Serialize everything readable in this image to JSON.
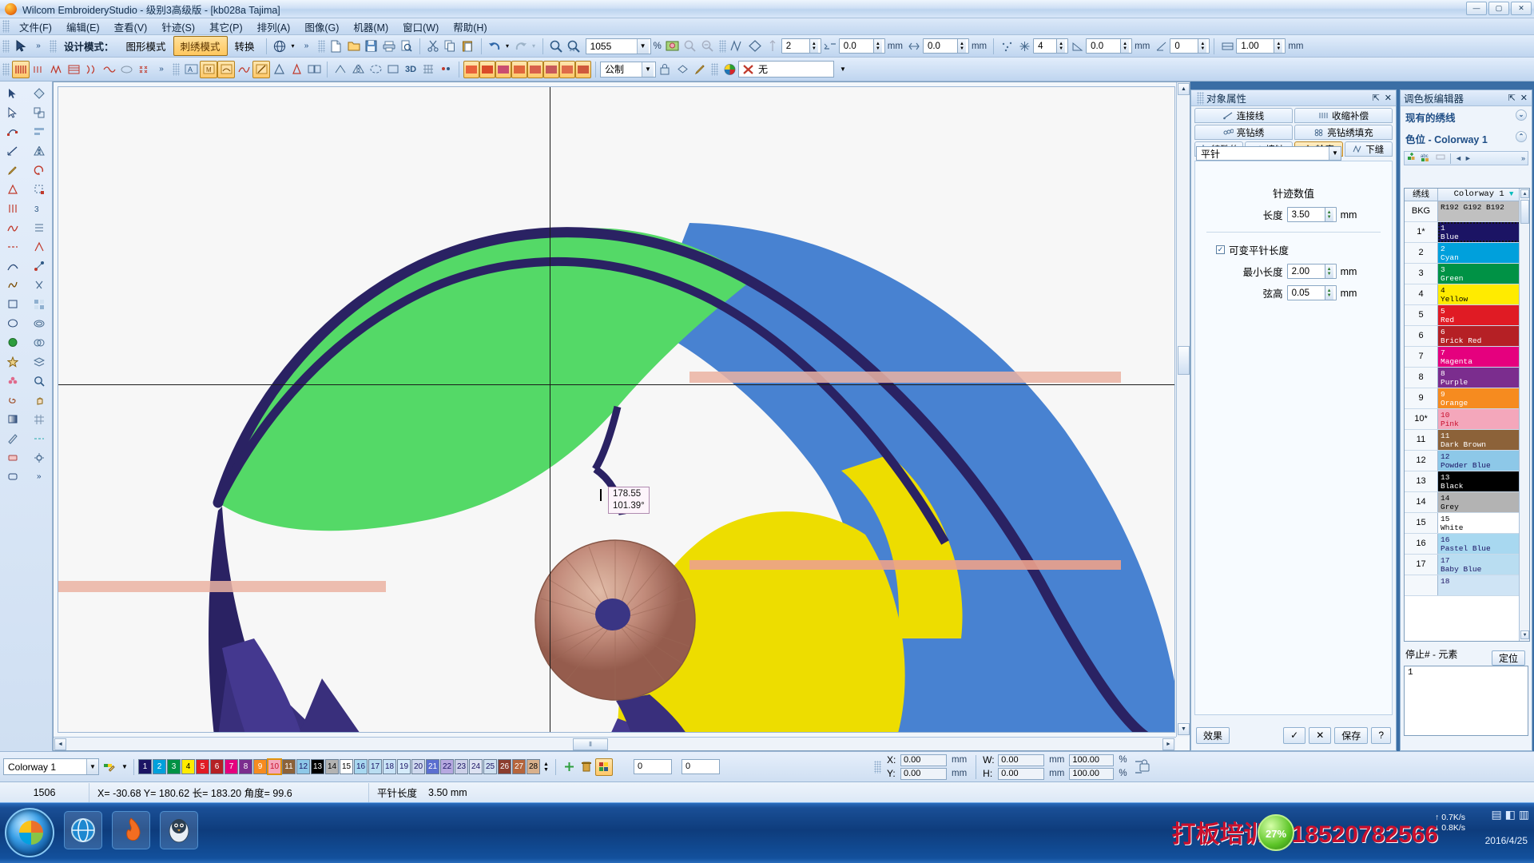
{
  "window": {
    "title": "Wilcom EmbroideryStudio - 级别3高级版 - [kb028a            Tajima]",
    "minimize": "—",
    "maximize": "▢",
    "close": "✕"
  },
  "menu": [
    "文件(F)",
    "编辑(E)",
    "查看(V)",
    "针迹(S)",
    "其它(P)",
    "排列(A)",
    "图像(G)",
    "机器(M)",
    "窗口(W)",
    "帮助(H)"
  ],
  "toolbar_mode": {
    "label": "设计模式：",
    "graphic": "图形模式",
    "embroidery": "刺绣模式",
    "convert": "转换"
  },
  "toolbar_values": {
    "zoom": "1055",
    "zoom_unit": "%",
    "f1": "0.0",
    "u1": "mm",
    "f2": "2",
    "f3": "0.0",
    "u3": "mm",
    "f4": "4",
    "f5": "0.0",
    "u5": "mm",
    "f6": "0",
    "f7": "1.00",
    "u7": "mm"
  },
  "toolbar_row2": {
    "layer_combo": "公制",
    "none_label": "无"
  },
  "canvas": {
    "tooltip_len": "178.55",
    "tooltip_angle": "101.39°"
  },
  "object_properties": {
    "title": "对象属性",
    "pin": "⇱",
    "close": "✕",
    "tabs_row1": [
      "连接线",
      "收缩补偿"
    ],
    "tabs_row2": [
      "亮钻绣",
      "亮钻绣填充"
    ],
    "tabs_row3": [
      "特殊的",
      "填针",
      "轮廓",
      "下缝"
    ],
    "active_tab": "轮廓",
    "stitch_type": "平针",
    "group_title": "针迹数值",
    "length_label": "长度",
    "length_value": "3.50",
    "length_unit": "mm",
    "variable_checkbox": "可变平针长度",
    "min_length_label": "最小长度",
    "min_length_value": "2.00",
    "min_length_unit": "mm",
    "chord_label": "弦高",
    "chord_value": "0.05",
    "chord_unit": "mm",
    "footer": {
      "effect": "效果",
      "apply": "✓",
      "cancel": "✕",
      "save": "保存",
      "help": "?"
    }
  },
  "palette": {
    "title": "调色板编辑器",
    "pin": "⇱",
    "close": "✕",
    "section_existing": "现有的绣线",
    "section_colorway": "色位 - Colorway 1",
    "header_thread": "绣线",
    "header_colorway": "Colorway 1",
    "rows": [
      {
        "n": "BKG",
        "num": "",
        "name": "R192 G192 B192",
        "color": "#c0c0c0",
        "text": "#000000",
        "selected": false
      },
      {
        "n": "1*",
        "num": "1",
        "name": "Blue",
        "color": "#1b1464",
        "text": "#ffffff",
        "selected": true
      },
      {
        "n": "2",
        "num": "2",
        "name": "Cyan",
        "color": "#00a0dc",
        "text": "#ffffff",
        "selected": false
      },
      {
        "n": "3",
        "num": "3",
        "name": "Green",
        "color": "#009245",
        "text": "#ffffff",
        "selected": false
      },
      {
        "n": "4",
        "num": "4",
        "name": "Yellow",
        "color": "#ffeb00",
        "text": "#000000",
        "selected": false
      },
      {
        "n": "5",
        "num": "5",
        "name": "Red",
        "color": "#e01b24",
        "text": "#ffffff",
        "selected": false
      },
      {
        "n": "6",
        "num": "6",
        "name": "Brick Red",
        "color": "#b52025",
        "text": "#ffffff",
        "selected": false
      },
      {
        "n": "7",
        "num": "7",
        "name": "Magenta",
        "color": "#e5007e",
        "text": "#ffffff",
        "selected": false
      },
      {
        "n": "8",
        "num": "8",
        "name": "Purple",
        "color": "#7b2d8e",
        "text": "#ffffff",
        "selected": false
      },
      {
        "n": "9",
        "num": "9",
        "name": "Orange",
        "color": "#f68b1f",
        "text": "#ffffff",
        "selected": false
      },
      {
        "n": "10*",
        "num": "10",
        "name": "Pink",
        "color": "#f4a7bb",
        "text": "#c8102e",
        "selected": false
      },
      {
        "n": "11",
        "num": "11",
        "name": "Dark Brown",
        "color": "#8c6239",
        "text": "#ffffff",
        "selected": false
      },
      {
        "n": "12",
        "num": "12",
        "name": "Powder Blue",
        "color": "#8dc8e8",
        "text": "#1b1464",
        "selected": false
      },
      {
        "n": "13",
        "num": "13",
        "name": "Black",
        "color": "#000000",
        "text": "#ffffff",
        "selected": false
      },
      {
        "n": "14",
        "num": "14",
        "name": "Grey",
        "color": "#b3b3b3",
        "text": "#000000",
        "selected": false
      },
      {
        "n": "15",
        "num": "15",
        "name": "White",
        "color": "#ffffff",
        "text": "#000000",
        "selected": false
      },
      {
        "n": "16",
        "num": "16",
        "name": "Pastel Blue",
        "color": "#a8d8f0",
        "text": "#1b1464",
        "selected": false
      },
      {
        "n": "17",
        "num": "17",
        "name": "Baby Blue",
        "color": "#b9ddf1",
        "text": "#1b1464",
        "selected": false
      },
      {
        "n": "",
        "num": "18",
        "name": "",
        "color": "#cfe4f5",
        "text": "#1b1464",
        "selected": false
      }
    ],
    "stop_label": "停止# - 元素",
    "locate_button": "定位",
    "stop_value": "1"
  },
  "color_strip": {
    "colorway": "Colorway 1",
    "swatches": [
      {
        "n": "1",
        "color": "#1b1464",
        "text": "#ffffff",
        "selected": false
      },
      {
        "n": "2",
        "color": "#00a0dc",
        "text": "#ffffff",
        "selected": false
      },
      {
        "n": "3",
        "color": "#009245",
        "text": "#ffffff",
        "selected": false
      },
      {
        "n": "4",
        "color": "#ffeb00",
        "text": "#000000",
        "selected": false
      },
      {
        "n": "5",
        "color": "#e01b24",
        "text": "#ffffff",
        "selected": false
      },
      {
        "n": "6",
        "color": "#b52025",
        "text": "#ffffff",
        "selected": false
      },
      {
        "n": "7",
        "color": "#e5007e",
        "text": "#ffffff",
        "selected": false
      },
      {
        "n": "8",
        "color": "#7b2d8e",
        "text": "#ffffff",
        "selected": false
      },
      {
        "n": "9",
        "color": "#f68b1f",
        "text": "#ffffff",
        "selected": false
      },
      {
        "n": "10",
        "color": "#f4a7bb",
        "text": "#c8102e",
        "selected": true
      },
      {
        "n": "11",
        "color": "#8c6239",
        "text": "#ffffff",
        "selected": false
      },
      {
        "n": "12",
        "color": "#8dc8e8",
        "text": "#1b1464",
        "selected": false
      },
      {
        "n": "13",
        "color": "#000000",
        "text": "#ffffff",
        "selected": false
      },
      {
        "n": "14",
        "color": "#b3b3b3",
        "text": "#000000",
        "selected": false
      },
      {
        "n": "15",
        "color": "#ffffff",
        "text": "#000000",
        "selected": false
      },
      {
        "n": "16",
        "color": "#a8d8f0",
        "text": "#1b1464",
        "selected": false
      },
      {
        "n": "17",
        "color": "#b9ddf1",
        "text": "#1b1464",
        "selected": false
      },
      {
        "n": "18",
        "color": "#c9e3f7",
        "text": "#1b1464",
        "selected": false
      },
      {
        "n": "19",
        "color": "#d5ebfa",
        "text": "#1b1464",
        "selected": false
      },
      {
        "n": "20",
        "color": "#cfd9ee",
        "text": "#1b1464",
        "selected": false
      },
      {
        "n": "21",
        "color": "#5b6fd0",
        "text": "#ffffff",
        "selected": false
      },
      {
        "n": "22",
        "color": "#b6a8e0",
        "text": "#1b1464",
        "selected": false
      },
      {
        "n": "23",
        "color": "#ccd0e8",
        "text": "#1b1464",
        "selected": false
      },
      {
        "n": "24",
        "color": "#dde2f2",
        "text": "#1b1464",
        "selected": false
      },
      {
        "n": "25",
        "color": "#cfe0f0",
        "text": "#1b1464",
        "selected": false
      },
      {
        "n": "26",
        "color": "#8b3d2e",
        "text": "#ffffff",
        "selected": false
      },
      {
        "n": "27",
        "color": "#b5653c",
        "text": "#ffffff",
        "selected": false
      },
      {
        "n": "28",
        "color": "#d8b08c",
        "text": "#000000",
        "selected": false
      }
    ],
    "field_a": "0",
    "field_b": "0",
    "coords": {
      "x_label": "X:",
      "x_value": "0.00",
      "x_unit": "mm",
      "y_label": "Y:",
      "y_value": "0.00",
      "y_unit": "mm",
      "w_label": "W:",
      "w_value": "0.00",
      "w_unit": "mm",
      "w_pct": "100.00",
      "pct": "%",
      "h_label": "H:",
      "h_value": "0.00",
      "h_unit": "mm",
      "h_pct": "100.00"
    }
  },
  "statusbar": {
    "stitch_count": "1506",
    "coords": "X= -30.68 Y= 180.62 长= 183.20 角度=  99.6",
    "stitch_len_label": "平针长度",
    "stitch_len_value": "3.50 mm"
  },
  "taskbar": {
    "promo": "打板培训：18520782566",
    "cpu": "27%",
    "net_up": "0.7K/s",
    "net_down": "0.8K/s",
    "date": "2016/4/25"
  }
}
